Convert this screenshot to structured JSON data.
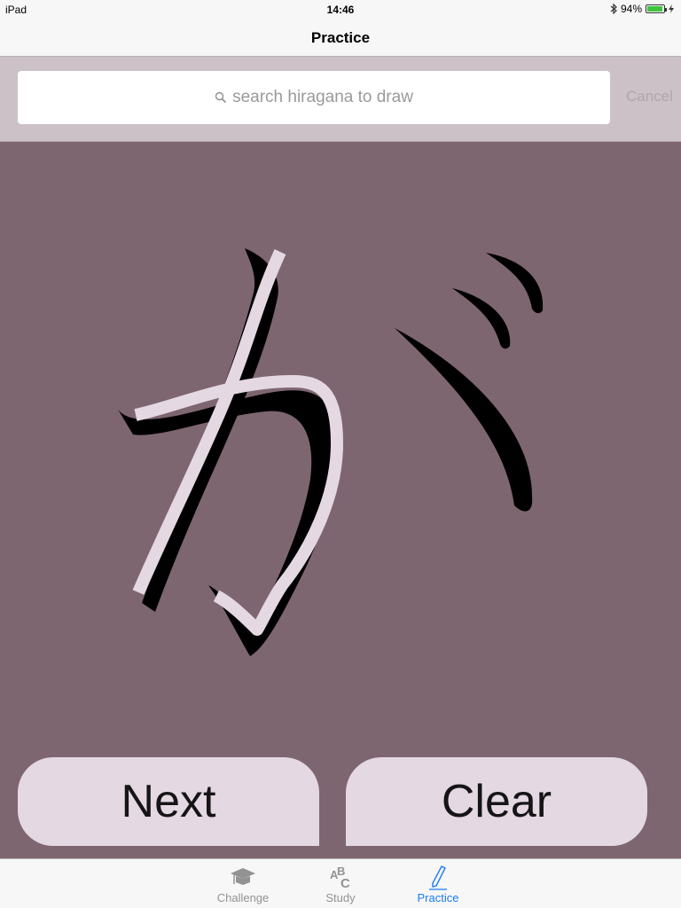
{
  "status_bar": {
    "device": "iPad",
    "time": "14:46",
    "battery": "94%",
    "battery_level": 0.94
  },
  "nav": {
    "title": "Practice"
  },
  "search": {
    "placeholder": "search hiragana to draw",
    "cancel_label": "Cancel"
  },
  "practice": {
    "character": "が"
  },
  "buttons": {
    "next_label": "Next",
    "clear_label": "Clear"
  },
  "tabs": [
    {
      "label": "Challenge",
      "icon": "graduation-cap-icon",
      "active": false
    },
    {
      "label": "Study",
      "icon": "abc-icon",
      "active": false
    },
    {
      "label": "Practice",
      "icon": "pencil-icon",
      "active": true
    }
  ],
  "colors": {
    "canvas": "#7e6670",
    "stroke": "#e4d8e2",
    "accent": "#1a7cf5"
  }
}
